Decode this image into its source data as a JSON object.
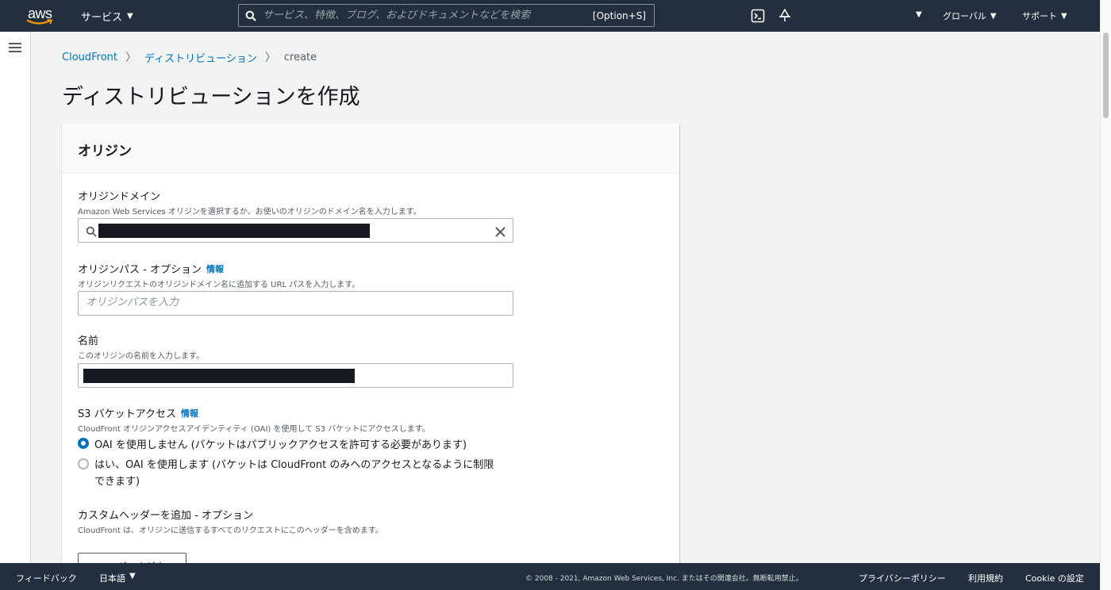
{
  "topnav": {
    "logo_text": "aws",
    "services_label": "サービス",
    "search_placeholder": "サービス、特徴、ブログ、およびドキュメントなどを検索",
    "search_shortcut": "[Option+S]",
    "region_label": "グローバル",
    "support_label": "サポート"
  },
  "breadcrumb": {
    "items": [
      "CloudFront",
      "ディストリビューション",
      "create"
    ]
  },
  "page": {
    "title": "ディストリビューションを作成"
  },
  "origin_section": {
    "title": "オリジン",
    "domain": {
      "label": "オリジンドメイン",
      "description": "Amazon Web Services オリジンを選択するか、お使いのオリジンのドメイン名を入力します。"
    },
    "path": {
      "label": "オリジンパス - オプション",
      "info": "情報",
      "description": "オリジンリクエストのオリジンドメイン名に追加する URL パスを入力します。",
      "placeholder": "オリジンパスを入力"
    },
    "name": {
      "label": "名前",
      "description": "このオリジンの名前を入力します。"
    },
    "s3_access": {
      "label": "S3 バケットアクセス",
      "info": "情報",
      "description": "CloudFront オリジンアクセスアイデンティティ (OAI) を使用して S3 バケットにアクセスします。",
      "options": [
        {
          "label": "OAI を使用しません (バケットはパブリックアクセスを許可する必要があります)",
          "selected": true
        },
        {
          "label_line1": "はい、OAI を使用します (バケットは CloudFront のみへのアクセスとなるように制限",
          "label_line2": "できます)",
          "selected": false
        }
      ]
    },
    "custom_header": {
      "label": "カスタムヘッダーを追加 - オプション",
      "description": "CloudFront は、オリジンに送信するすべてのリクエストにこのヘッダーを含めます。",
      "add_button": "ヘッダーを追加"
    }
  },
  "footer": {
    "feedback": "フィードバック",
    "language": "日本語",
    "copyright": "© 2008 - 2021, Amazon Web Services, Inc. またはその関連会社。無断転用禁止。",
    "privacy": "プライバシーポリシー",
    "terms": "利用規約",
    "cookie": "Cookie の設定"
  },
  "colors": {
    "nav_bg": "#232f3e",
    "link": "#0073bb",
    "page_bg": "#f2f3f3",
    "smile": "#ff9900"
  }
}
